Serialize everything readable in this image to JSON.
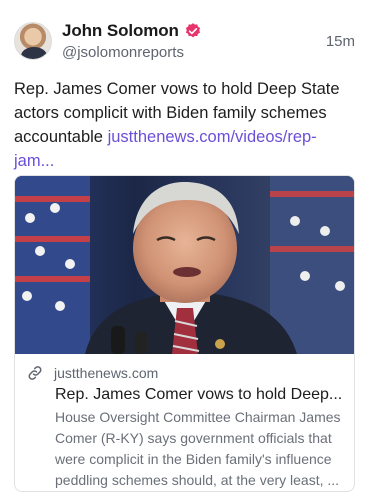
{
  "post": {
    "author": {
      "name": "John Solomon",
      "handle": "@jsolomonreports",
      "verified_color": "#e8336b"
    },
    "time": "15m",
    "text": "Rep. James Comer vows to hold Deep State actors complicit with Biden family schemes accountable ",
    "link_text": "justthenews.com/videos/rep-jam...",
    "link_color": "#6b4fd8"
  },
  "card": {
    "domain": "justthenews.com",
    "title": "Rep. James Comer vows to hold Deep...",
    "description_lines": [
      "House Oversight Committee Chairman James",
      "Comer (R-KY) says government officials that",
      "were complicit in the Biden family's influence",
      "peddling schemes should, at the very least, ..."
    ]
  },
  "icons": {
    "verified": "verified-badge-icon",
    "link": "link-icon"
  }
}
